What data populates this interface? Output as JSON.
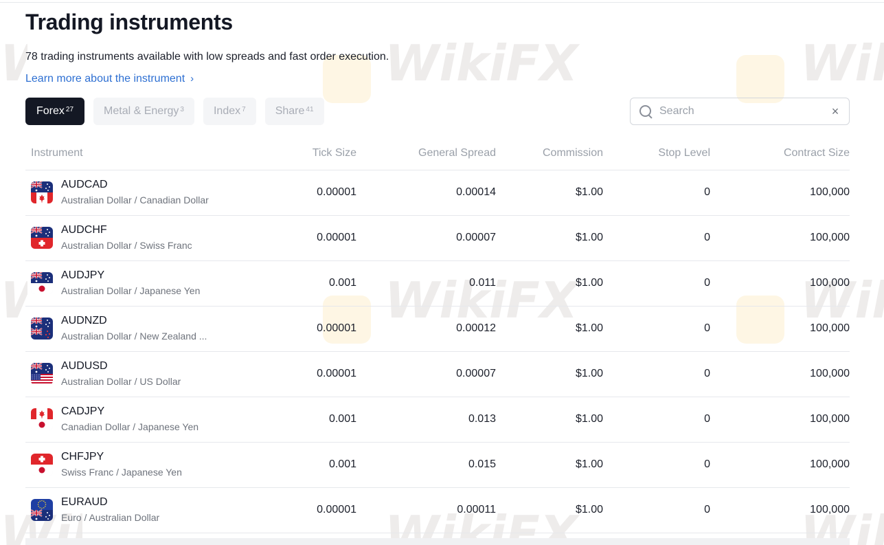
{
  "header": {
    "title": "Trading instruments",
    "subtitle": "78 trading instruments available with low spreads and fast order execution.",
    "learn_more": "Learn more about the instrument",
    "learn_more_chevron": "›"
  },
  "tabs": [
    {
      "label": "Forex",
      "count": "27",
      "active": true
    },
    {
      "label": "Metal & Energy",
      "count": "3",
      "active": false
    },
    {
      "label": "Index",
      "count": "7",
      "active": false
    },
    {
      "label": "Share",
      "count": "41",
      "active": false
    }
  ],
  "search": {
    "placeholder": "Search",
    "value": "",
    "clear_glyph": "×",
    "icon": "search-icon"
  },
  "table": {
    "columns": [
      "Instrument",
      "Tick Size",
      "General Spread",
      "Commission",
      "Stop Level",
      "Contract Size"
    ],
    "rows": [
      {
        "symbol": "AUDCAD",
        "name": "Australian Dollar / Canadian Dollar",
        "tick": "0.00001",
        "spread": "0.00014",
        "commission": "$1.00",
        "stop": "0",
        "contract": "100,000",
        "flags": [
          "au",
          "ca"
        ]
      },
      {
        "symbol": "AUDCHF",
        "name": "Australian Dollar / Swiss Franc",
        "tick": "0.00001",
        "spread": "0.00007",
        "commission": "$1.00",
        "stop": "0",
        "contract": "100,000",
        "flags": [
          "au",
          "ch"
        ]
      },
      {
        "symbol": "AUDJPY",
        "name": "Australian Dollar / Japanese Yen",
        "tick": "0.001",
        "spread": "0.011",
        "commission": "$1.00",
        "stop": "0",
        "contract": "100,000",
        "flags": [
          "au",
          "jp"
        ]
      },
      {
        "symbol": "AUDNZD",
        "name": "Australian Dollar / New Zealand ...",
        "tick": "0.00001",
        "spread": "0.00012",
        "commission": "$1.00",
        "stop": "0",
        "contract": "100,000",
        "flags": [
          "au",
          "nz"
        ]
      },
      {
        "symbol": "AUDUSD",
        "name": "Australian Dollar / US Dollar",
        "tick": "0.00001",
        "spread": "0.00007",
        "commission": "$1.00",
        "stop": "0",
        "contract": "100,000",
        "flags": [
          "au",
          "us"
        ]
      },
      {
        "symbol": "CADJPY",
        "name": "Canadian Dollar / Japanese Yen",
        "tick": "0.001",
        "spread": "0.013",
        "commission": "$1.00",
        "stop": "0",
        "contract": "100,000",
        "flags": [
          "ca",
          "jp"
        ]
      },
      {
        "symbol": "CHFJPY",
        "name": "Swiss Franc / Japanese Yen",
        "tick": "0.001",
        "spread": "0.015",
        "commission": "$1.00",
        "stop": "0",
        "contract": "100,000",
        "flags": [
          "ch",
          "jp"
        ]
      },
      {
        "symbol": "EURAUD",
        "name": "Euro / Australian Dollar",
        "tick": "0.00001",
        "spread": "0.00011",
        "commission": "$1.00",
        "stop": "0",
        "contract": "100,000",
        "flags": [
          "eu",
          "au"
        ]
      }
    ]
  },
  "watermark": {
    "text": "WikiFX"
  },
  "colors": {
    "accent_link": "#2d6fd2",
    "active_tab": "#141824",
    "muted": "#9aa0a9"
  }
}
